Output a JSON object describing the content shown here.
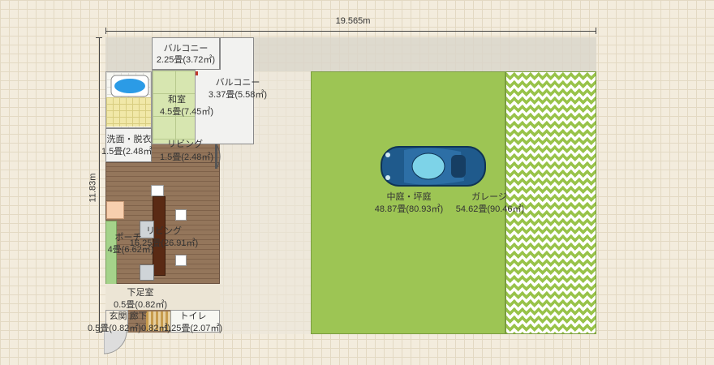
{
  "dimensions": {
    "width_label": "19.565m",
    "height_label": "11.83m"
  },
  "rooms": {
    "balcony1": {
      "name": "バルコニー",
      "area": "2.25畳(3.72㎡)"
    },
    "balcony2": {
      "name": "バルコニー",
      "area": "3.37畳(5.58㎡)"
    },
    "washitsu": {
      "name": "和室",
      "area": "4.5畳(7.45㎡)"
    },
    "senmen": {
      "name": "洗面・脱衣",
      "area": "1.5畳(2.48㎡)"
    },
    "living_small": {
      "name": "リビング",
      "area": "1.5畳(2.48㎡)"
    },
    "living": {
      "name": "リビング",
      "area": "16.25畳(26.91㎡)"
    },
    "porch": {
      "name": "ポーチ",
      "area": "4畳(6.62㎡)"
    },
    "geshoku": {
      "name": "下足室",
      "area": "0.5畳(0.82㎡)"
    },
    "genkan_row": {
      "name": "玄関 廊下",
      "area": "0.5畳(0.82㎡)0.82㎡)",
      "area2": "1.25畳(2.07㎡)"
    },
    "toilet": {
      "name": "トイレ"
    },
    "courtyard": {
      "name": "中庭・坪庭",
      "area": "48.87畳(80.93㎡)"
    },
    "garage": {
      "name": "ガレージ",
      "area": "54.62畳(90.46㎡)"
    }
  },
  "colors": {
    "grass": "#9dc554",
    "car": "#1f5a8c",
    "wood": "#8c6d52"
  },
  "icons": [
    "bathtub-icon",
    "car-icon",
    "dining-table-icon",
    "chair-icon",
    "door-swing-icon"
  ]
}
